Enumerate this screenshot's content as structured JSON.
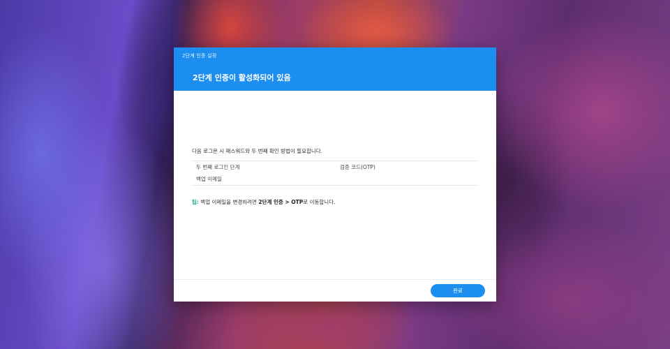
{
  "window": {
    "title": "2단계 인증 설정"
  },
  "dialog": {
    "heading": "2단계 인증이 활성화되어 있음",
    "description": "다음 로그온 시 패스워드와 두 번째 확인 방법이 필요합니다.",
    "settings": [
      {
        "label": "두 번째 로그인 단계",
        "value": "검증 코드(OTP)"
      },
      {
        "label": "백업 이메일",
        "value": ""
      }
    ],
    "tip": {
      "label": "팁:",
      "text_before": " 백업 이메일을 변경하려면 ",
      "path": "2단계 인증 > OTP",
      "text_after": "로 이동합니다."
    },
    "done_label": "완료"
  },
  "colors": {
    "accent": "#1b8ef0",
    "tip": "#1fa88e"
  }
}
